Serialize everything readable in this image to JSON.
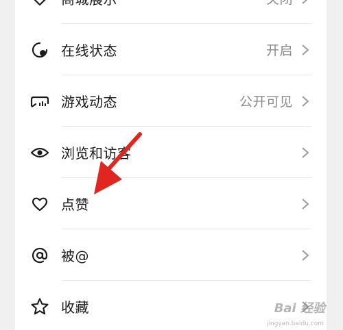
{
  "settings": {
    "items": [
      {
        "label": "商城展示",
        "value": "关闭",
        "icon": "heart-shield-icon"
      },
      {
        "label": "在线状态",
        "value": "开启",
        "icon": "online-status-icon"
      },
      {
        "label": "游戏动态",
        "value": "公开可见",
        "icon": "gamepad-icon"
      },
      {
        "label": "浏览和访客",
        "value": "",
        "icon": "eye-icon"
      },
      {
        "label": "点赞",
        "value": "",
        "icon": "heart-icon"
      },
      {
        "label": "被@",
        "value": "",
        "icon": "at-icon"
      },
      {
        "label": "收藏",
        "value": "",
        "icon": "star-icon"
      }
    ]
  },
  "annotation": {
    "arrow_color": "#e0261e"
  },
  "watermark": {
    "text": "Bai 经验",
    "sub": "jingyan.baidu.com"
  }
}
